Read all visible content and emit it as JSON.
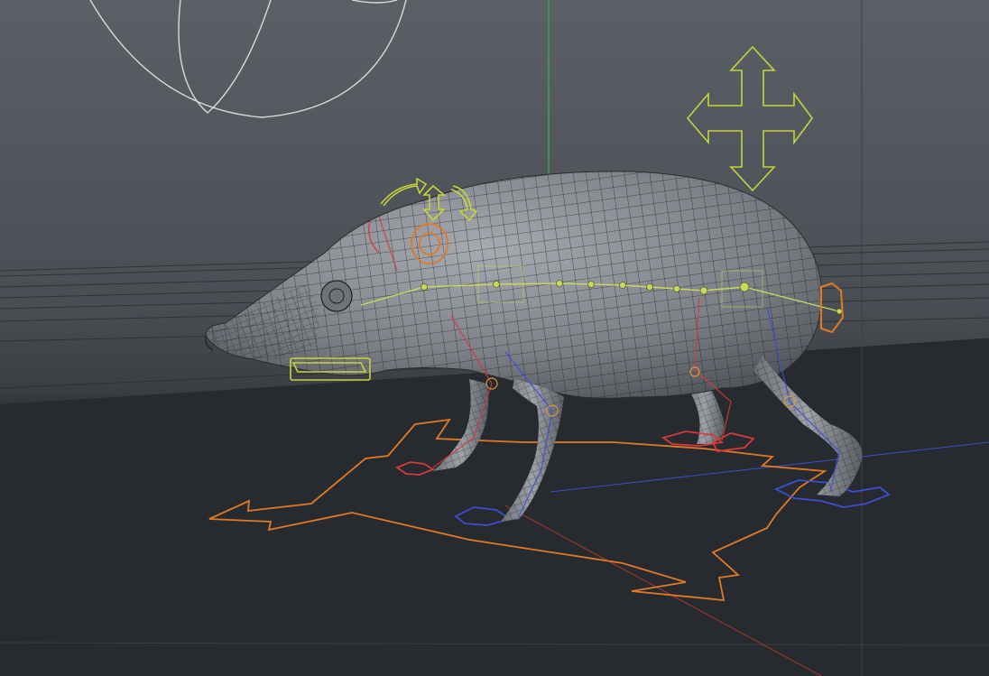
{
  "viewport": {
    "background_top": "#5d6268",
    "background_mid": "#42464c",
    "floor": "#2b2e33",
    "axis_colors": {
      "x": "#c0392b",
      "y": "#3fae49",
      "z": "#3549c8"
    }
  },
  "rig": {
    "mesh_color": "#8a8e94",
    "wire_color": "#1d1f23",
    "spine_color": "#c8d85a",
    "controls": [
      {
        "name": "move-gizmo",
        "color": "#c6d43a",
        "icon": "four-way-arrow-icon"
      },
      {
        "name": "root-control",
        "color": "#e07a25",
        "icon": "root-arrows-icon"
      },
      {
        "name": "head-control",
        "color": "#c6d43a",
        "icon": "head-arrows-icon"
      },
      {
        "name": "jaw-control",
        "color": "#c6d43a",
        "icon": "jaw-rect-icon"
      },
      {
        "name": "ear-control",
        "color": "#e07a25",
        "icon": "ear-ring-icon"
      },
      {
        "name": "tail-control",
        "color": "#e07a25",
        "icon": "tail-ring-icon"
      }
    ],
    "left_limb_color": "#d63a3a",
    "right_limb_color": "#3a4fd6"
  }
}
